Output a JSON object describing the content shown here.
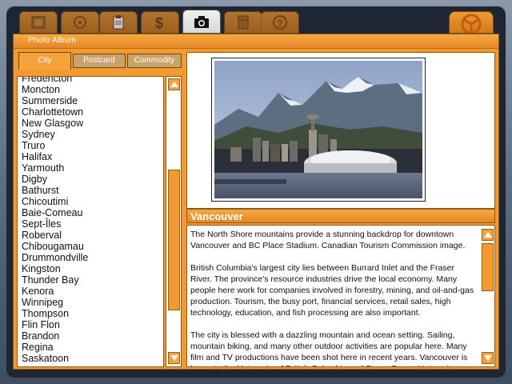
{
  "toolbar": {
    "tabs": [
      {
        "name": "notebook-tab",
        "icon": "notebook-icon"
      },
      {
        "name": "travel-tab",
        "icon": "car-icon"
      },
      {
        "name": "clipboard-tab",
        "icon": "clipboard-icon"
      },
      {
        "name": "money-tab",
        "icon": "dollar-icon"
      },
      {
        "name": "photo-tab",
        "icon": "camera-icon",
        "active": true
      },
      {
        "name": "notes-tab",
        "icon": "notepad-icon"
      },
      {
        "name": "help-tab",
        "icon": "question-icon"
      }
    ],
    "wheel_icon": "steering-wheel-icon"
  },
  "panel": {
    "title": "Photo Album"
  },
  "subtabs": {
    "city": "City",
    "postcard": "Postcard",
    "commodity": "Commodity",
    "active": "city"
  },
  "cities": [
    "Fredericton",
    "Moncton",
    "Summerside",
    "Charlottetown",
    "New Glasgow",
    "Sydney",
    "Truro",
    "Halifax",
    "Yarmouth",
    "Digby",
    "Bathurst",
    "Chicoutimi",
    "Baie-Comeau",
    "Sept-Îles",
    "Roberval",
    "Chibougamau",
    "Drummondville",
    "Kingston",
    "Thunder Bay",
    "Kenora",
    "Winnipeg",
    "Thompson",
    "Flin Flon",
    "Brandon",
    "Regina",
    "Saskatoon"
  ],
  "selected_city": {
    "name": "Vancouver",
    "paragraphs": [
      "The North Shore mountains provide a stunning backdrop for downtown Vancouver and BC Place Stadium. Canadian Tourism Commission image.",
      "British Columbia's largest city lies between Burrard Inlet and the Fraser River. The province's resource industries drive the local economy. Many people here work for companies involved in forestry, mining, and oil-and-gas production. Tourism, the busy port, financial services, retail sales, high technology, education, and fish processing are also important.",
      "The city is blessed with a dazzling mountain and ocean setting. Sailing, mountain biking, and many other outdoor activities are popular here. Many film and TV productions have been shot here in recent years. Vancouver is home to the University of British Columbia and Simon Fraser University."
    ]
  },
  "colors": {
    "accent": "#f29a2e",
    "frame": "#5b6b80"
  }
}
